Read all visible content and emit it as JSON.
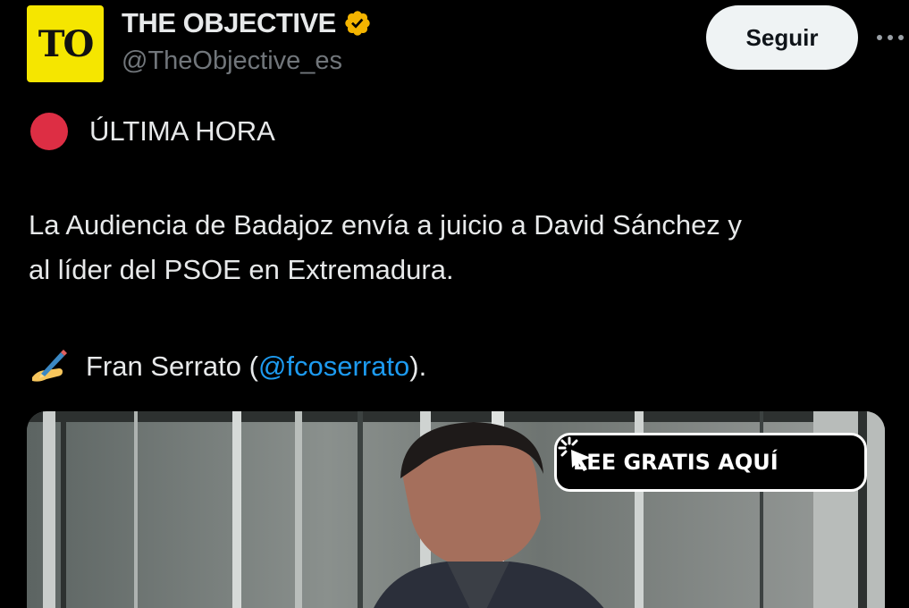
{
  "account": {
    "avatar_text": "TO",
    "display_name": "THE OBJECTIVE",
    "handle": "@TheObjective_es",
    "verified": true,
    "verified_color": "#f4b400",
    "avatar_color": "#f5e600"
  },
  "actions": {
    "follow_label": "Seguir",
    "more_icon": "more-dots-icon"
  },
  "tweet": {
    "breaking_icon": "red-circle-emoji",
    "breaking_label": "ÚLTIMA HORA",
    "text_line1": "La Audiencia de Badajoz envía a juicio a David Sánchez y",
    "text_line2": "al líder del PSOE en Extremadura.",
    "author_icon": "writing-hand-emoji",
    "author_prefix": "Fran Serrato (",
    "author_mention": "@fcoserrato",
    "author_suffix": ")."
  },
  "media": {
    "promo_label": "LEE GRATIS AQUÍ",
    "promo_icon": "cursor-click-icon"
  },
  "colors": {
    "background": "#000000",
    "text": "#e7e9ea",
    "secondary_text": "#71767b",
    "link": "#1d9bf0",
    "breaking_red": "#dd2e44"
  }
}
